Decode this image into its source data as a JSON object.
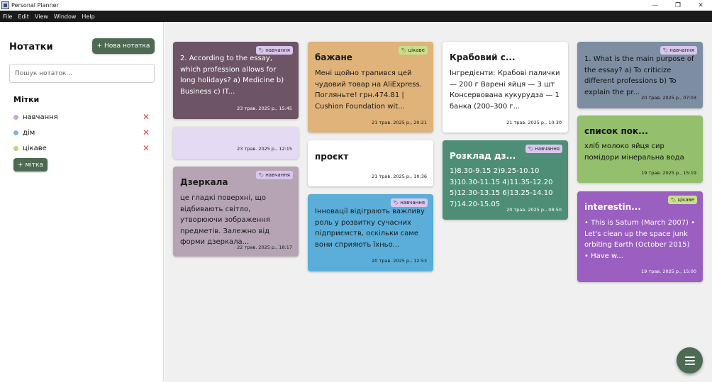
{
  "window": {
    "title": "Personal Planner",
    "minimize": "—",
    "maximize": "❐",
    "close": "✕"
  },
  "menu": [
    "File",
    "Edit",
    "View",
    "Window",
    "Help"
  ],
  "sidebar": {
    "title": "Нотатки",
    "new_note_label": "+ Нова нотатка",
    "search_placeholder": "Пошук нотаток...",
    "tags_title": "Мітки",
    "tags": [
      {
        "label": "навчання",
        "color": "#c9a6df"
      },
      {
        "label": "дім",
        "color": "#7fb4de"
      },
      {
        "label": "цікаве",
        "color": "#bcd67e"
      }
    ],
    "delete_glyph": "✕",
    "add_tag_label": "+ мітка"
  },
  "notes": [
    {
      "title": "",
      "body": "2. According to the essay, which profession allows for long holidays? a) Medicine b) Business c) IT...",
      "date": "23 трав. 2025 р., 15:45",
      "tag": "навчання",
      "bg": "#6e5566",
      "text": "#ffffff"
    },
    {
      "title": "",
      "body": "",
      "date": "23 трав. 2025 р., 12:15",
      "tag": "",
      "bg": "#e4daf3",
      "text": "#222222"
    },
    {
      "title": "Дзеркала",
      "body": "це гладкі поверхні, що відбивають світло, утворюючи зображення предметів. Залежно від форми дзеркала...",
      "date": "22 трав. 2025 р., 18:17",
      "tag": "навчання",
      "bg": "#b6a4b4",
      "text": "#1a1a1a"
    },
    {
      "title": "бажане",
      "body": "Мені щойно трапився цей чудовий товар на AliExpress. Погляньте! грн.474.81 | Cushion Foundation wit...",
      "date": "21 трав. 2025 р., 20:21",
      "tag": "цікаве",
      "bg": "#dfb379",
      "text": "#1a1a1a"
    },
    {
      "title": "проєкт",
      "body": "",
      "date": "21 трав. 2025 р., 10:36",
      "tag": "",
      "bg": "#ffffff",
      "text": "#1a1a1a"
    },
    {
      "title": "",
      "body": "Інновації відіграють важливу роль у розвитку сучасних підприємств, оскільки саме вони сприяють їхньо...",
      "date": "20 трав. 2025 р., 12:53",
      "tag": "навчання",
      "bg": "#5aaed9",
      "text": "#1a1a1a"
    },
    {
      "title": "Крабовий с...",
      "body": "Інгредієнти: Крабові палички — 200 г Варені яйця — 3 шт Консервована кукурудза — 1 банка (200–300 г...",
      "date": "21 трав. 2025 р., 10:30",
      "tag": "",
      "bg": "#ffffff",
      "text": "#1a1a1a"
    },
    {
      "title": "Розклад дз...",
      "body": "1)8.30-9.15 2)9.25-10.10 3)10.30-11.15 4)11.35-12.20 5)12.30-13.15 6)13.25-14.10 7)14.20-15.05",
      "date": "20 трав. 2025 р., 08:50",
      "tag": "навчання",
      "bg": "#4f8e76",
      "text": "#ffffff"
    },
    {
      "title": "",
      "body": "1. What is the main purpose of the essay? a) To criticize different professions b) To explain the pr...",
      "date": "20 трав. 2025 р., 07:03",
      "tag": "навчання",
      "bg": "#7d8ea3",
      "text": "#111111"
    },
    {
      "title": "список пок...",
      "body": "хліб молоко яйця сир помідори мінеральна вода",
      "date": "19 трав. 2025 р., 15:19",
      "tag": "",
      "bg": "#94bf6c",
      "text": "#111111"
    },
    {
      "title": "interestin...",
      "body": "• This is Saturn (March 2007) • Let's clean up the space junk orbiting Earth (October 2015) • Have w...",
      "date": "19 трав. 2025 р., 15:00",
      "tag": "цікаве",
      "bg": "#9a5fc1",
      "text": "#ffffff"
    }
  ],
  "tag_colors": {
    "навчання": "#d9c6ec",
    "цікаве": "#c9e08a"
  },
  "tag_icon": "🏷"
}
